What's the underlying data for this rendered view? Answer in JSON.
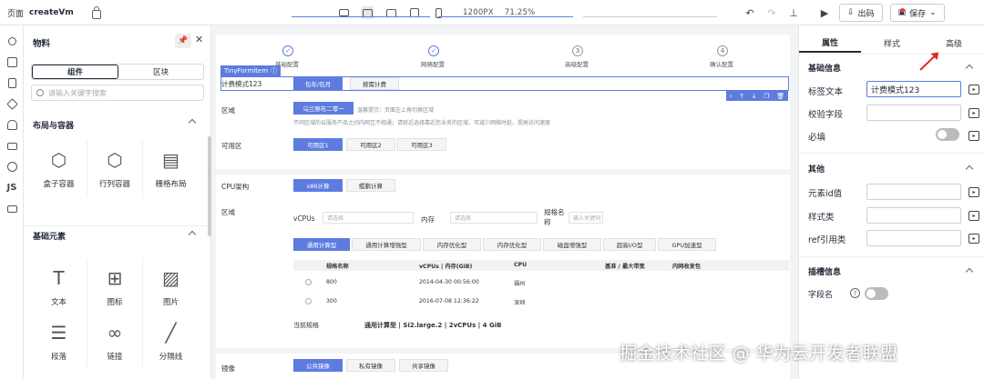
{
  "topbar": {
    "page_label": "页面",
    "page_name": "createVm",
    "canvas_width": "1200PX",
    "zoom": "71.25%",
    "export_label": "出码",
    "save_label": "保存"
  },
  "left_panel": {
    "title": "物料",
    "tabs": [
      "组件",
      "区块"
    ],
    "search_placeholder": "请输入关键字搜索",
    "groups": [
      {
        "title": "布局与容器",
        "items": [
          "盒子容器",
          "行列容器",
          "栅格布局"
        ]
      },
      {
        "title": "基础元素",
        "items": [
          "文本",
          "图标",
          "图片",
          "段落",
          "链接",
          "分隔线"
        ]
      }
    ]
  },
  "canvas": {
    "steps": [
      "基础配置",
      "网络配置",
      "高级配置",
      "确认配置"
    ],
    "step_numbers": [
      "3",
      "4"
    ],
    "selected_component": "TinyFormItem",
    "rows": {
      "billing": {
        "label": "计费模式123",
        "options": [
          "包年/包月",
          "按需计费"
        ]
      },
      "region": {
        "label": "区域",
        "value": "乌兰察布二零一",
        "hint": "温馨提示：页面左上角切换区域",
        "note": "不同区域的云服务产品之间内网互不相通；请就近选择靠近您业务的区域，可减少网络时延、提高访问速度"
      },
      "zone": {
        "label": "可用区",
        "options": [
          "可用区1",
          "可用区2",
          "可用区3"
        ]
      },
      "cpu": {
        "label": "CPU架构",
        "options": [
          "x86计算",
          "鲲鹏计算"
        ]
      },
      "spec_region": {
        "label": "区域"
      },
      "vcpus": {
        "label": "vCPUs",
        "placeholder": "请选择"
      },
      "memory": {
        "label": "内存",
        "placeholder": "请选择"
      },
      "spec_name": {
        "label": "规格名称",
        "placeholder": "输入关键词"
      },
      "spec_tabs": [
        "通用计算型",
        "通用计算增强型",
        "内存优化型",
        "内存优化型",
        "磁盘增强型",
        "超高I/O型",
        "GPU加速型"
      ],
      "table_headers": [
        "规格名称",
        "vCPUs | 内存(GiB)",
        "CPU",
        "基准 / 最大带宽",
        "内网收发包"
      ],
      "table_rows": [
        [
          "800",
          "2014-04-30 00:56:00",
          "福州"
        ],
        [
          "300",
          "2016-07-08 12:36:22",
          "深圳"
        ]
      ],
      "current_spec_label": "当前规格",
      "current_spec_value": "通用计算型 | Si2.large.2 | 2vCPUs | 4 GiB",
      "image": {
        "label": "镜像",
        "options": [
          "公共镜像",
          "私有镜像",
          "共享镜像"
        ]
      }
    }
  },
  "right_panel": {
    "tabs": [
      "属性",
      "样式",
      "高级"
    ],
    "sections": {
      "basic": "基础信息",
      "other": "其他",
      "slot": "插槽信息"
    },
    "fields": {
      "label_text": {
        "label": "标签文本",
        "value": "计费模式123"
      },
      "validate": {
        "label": "校验字段",
        "value": ""
      },
      "required": {
        "label": "必填"
      },
      "element_id": {
        "label": "元素id值",
        "value": ""
      },
      "style_class": {
        "label": "样式类",
        "value": ""
      },
      "ref": {
        "label": "ref引用类",
        "value": ""
      },
      "field_name": {
        "label": "字段名"
      }
    }
  },
  "watermark": "掘金技术社区 @ 华为云开发者联盟"
}
